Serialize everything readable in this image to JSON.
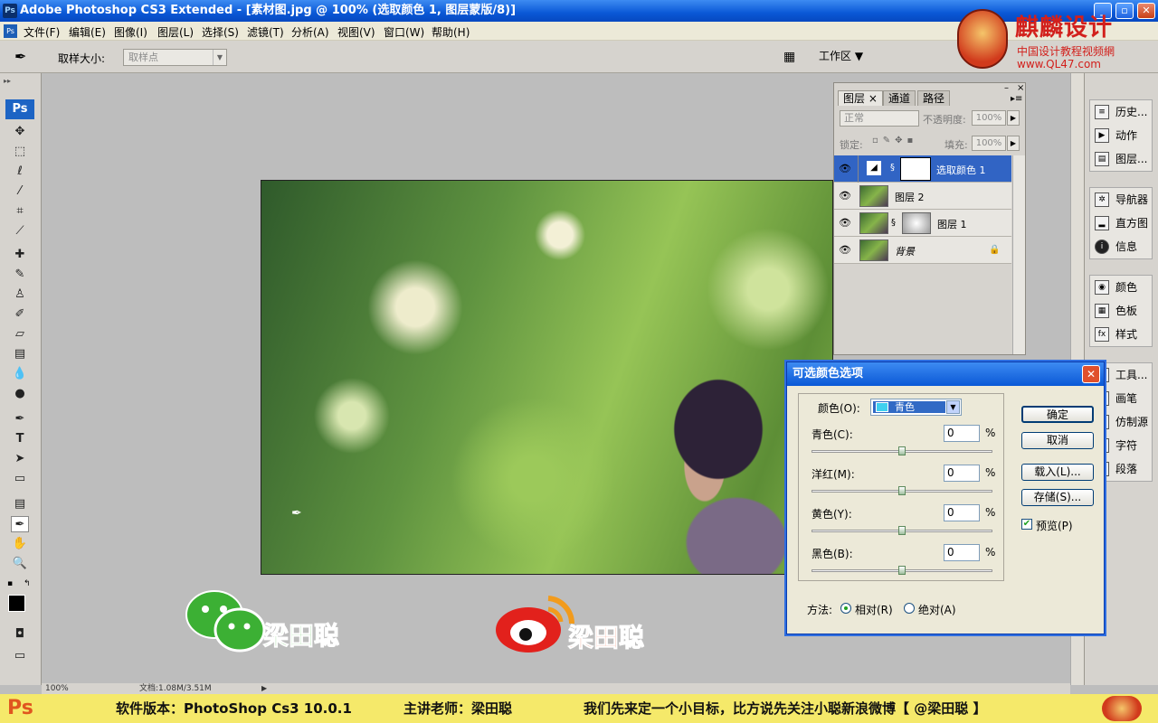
{
  "window": {
    "title": "Adobe Photoshop CS3 Extended - [素材图.jpg @ 100% (选取颜色 1, 图层蒙版/8)]",
    "app_icon": "Ps"
  },
  "menubar": [
    "文件(F)",
    "编辑(E)",
    "图像(I)",
    "图层(L)",
    "选择(S)",
    "滤镜(T)",
    "分析(A)",
    "视图(V)",
    "窗口(W)",
    "帮助(H)"
  ],
  "options": {
    "sample_size_label": "取样大小:",
    "sample_size_value": "取样点",
    "workspace_label": "工作区 ▼"
  },
  "toolbox": {
    "logo": "Ps"
  },
  "layers_panel": {
    "tabs": [
      "图层 ×",
      "通道",
      "路径"
    ],
    "blend_mode": "正常",
    "opacity_label": "不透明度:",
    "opacity_value": "100%",
    "lock_label": "锁定:",
    "fill_label": "填充:",
    "fill_value": "100%",
    "layers": [
      {
        "name": "选取颜色 1",
        "selected": true
      },
      {
        "name": "图层 2",
        "selected": false
      },
      {
        "name": "图层 1",
        "selected": false
      },
      {
        "name": "背景",
        "selected": false
      }
    ]
  },
  "dock": {
    "group1": [
      {
        "icon": "history-icon",
        "label": "历史..."
      },
      {
        "icon": "actions-icon",
        "label": "动作"
      },
      {
        "icon": "layer-comps-icon",
        "label": "图层..."
      }
    ],
    "group2": [
      {
        "icon": "navigator-icon",
        "label": "导航器"
      },
      {
        "icon": "histogram-icon",
        "label": "直方图"
      },
      {
        "icon": "info-icon",
        "label": "信息"
      }
    ],
    "group3": [
      {
        "icon": "color-icon",
        "label": "颜色"
      },
      {
        "icon": "swatches-icon",
        "label": "色板"
      },
      {
        "icon": "styles-icon",
        "label": "样式"
      }
    ],
    "group4": [
      {
        "icon": "tool-presets-icon",
        "label": "工具..."
      },
      {
        "icon": "brushes-icon",
        "label": "画笔"
      },
      {
        "icon": "clone-source-icon",
        "label": "仿制源"
      },
      {
        "icon": "character-icon",
        "label": "字符"
      },
      {
        "icon": "paragraph-icon",
        "label": "段落"
      }
    ]
  },
  "dialog": {
    "title": "可选颜色选项",
    "color_label": "颜色(O):",
    "color_value": "青色",
    "rows": [
      {
        "label": "青色(C):",
        "value": "0"
      },
      {
        "label": "洋红(M):",
        "value": "0"
      },
      {
        "label": "黄色(Y):",
        "value": "0"
      },
      {
        "label": "黑色(B):",
        "value": "0"
      }
    ],
    "percent": "%",
    "ok": "确定",
    "cancel": "取消",
    "load": "载入(L)...",
    "save": "存储(S)...",
    "preview": "预览(P)",
    "method_label": "方法:",
    "method_relative": "相对(R)",
    "method_absolute": "绝对(A)"
  },
  "watermarks": {
    "wechat_name": "梁田聪",
    "weibo_name": "梁田聪",
    "brand_main": "麒麟设计",
    "brand_sub": "中国设计教程视频網",
    "brand_url": "www.QL47.com"
  },
  "statusbar": {
    "zoom": "100%",
    "doc": "文档:1.08M/3.51M"
  },
  "banner": {
    "ps": "Ps",
    "version": "软件版本：PhotoShop Cs3 10.0.1",
    "teacher": "主讲老师：梁田聪",
    "slogan": "我们先来定一个小目标，比方说先关注小聪新浪微博【 @梁田聪 】"
  },
  "colors": {
    "accent": "#0a58d6",
    "selection": "#3164c4",
    "banner_bg": "#f5e96a"
  }
}
